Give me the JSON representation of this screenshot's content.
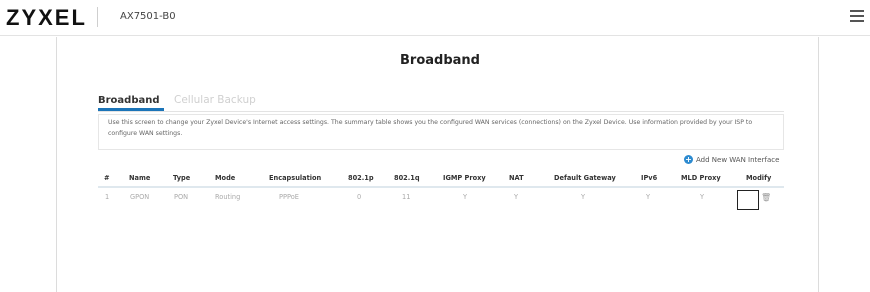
{
  "header": {
    "logo": "ZYXEL",
    "model": "AX7501-B0",
    "menu_icon": "hamburger-menu-icon"
  },
  "page": {
    "title": "Broadband"
  },
  "tabs": [
    {
      "label": "Broadband",
      "active": true
    },
    {
      "label": "Cellular Backup",
      "active": false
    }
  ],
  "description": "Use this screen to change your Zyxel Device's Internet access settings. The summary table shows you the configured WAN services (connections) on the Zyxel Device. Use information provided by your ISP to configure WAN settings.",
  "add_wan": {
    "label": "Add New WAN Interface",
    "icon": "add-circle-icon"
  },
  "table": {
    "columns": [
      "#",
      "Name",
      "Type",
      "Mode",
      "Encapsulation",
      "802.1p",
      "802.1q",
      "IGMP Proxy",
      "NAT",
      "Default Gateway",
      "IPv6",
      "MLD Proxy",
      "Modify"
    ],
    "rows": [
      [
        "1",
        "GPON",
        "PON",
        "Routing",
        "PPPoE",
        "0",
        "11",
        "Y",
        "Y",
        "Y",
        "Y",
        "Y",
        ""
      ]
    ]
  },
  "colors": {
    "accent": "#1b74b8",
    "add_icon": "#2d8bd0"
  }
}
